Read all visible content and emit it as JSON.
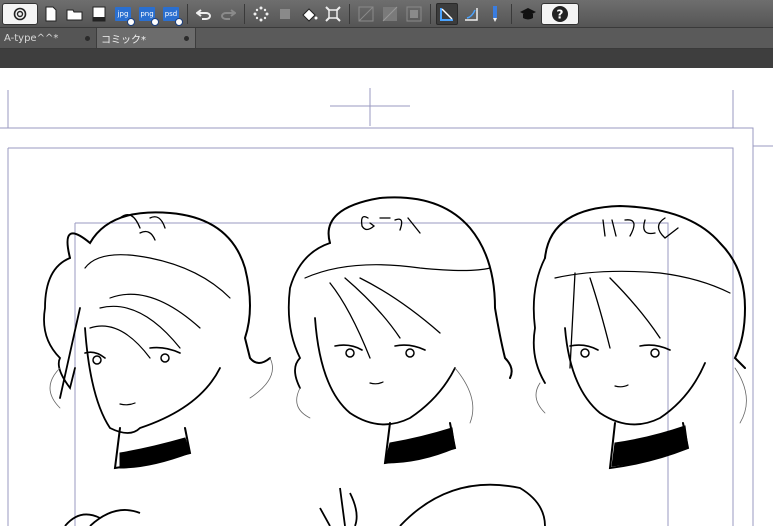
{
  "toolbar": {
    "icons": [
      "app-logo-icon",
      "new-file-icon",
      "open-folder-icon",
      "save-icon",
      "export-jpg-icon",
      "export-png-icon",
      "export-psd-icon",
      "undo-icon",
      "redo-icon",
      "sparkle-icon",
      "transform-icon",
      "fill-icon",
      "crop-icon",
      "grid-icon",
      "ruler-icon",
      "frame-icon",
      "snap-ruler-icon",
      "snap-special-icon",
      "pen-icon",
      "learn-icon",
      "help-icon"
    ],
    "export_jpg": "jpg",
    "export_png": "png",
    "export_psd": "psd",
    "help_symbol": "?"
  },
  "tabs": [
    {
      "label": "A-type^^*",
      "active": false
    },
    {
      "label": "コミック*",
      "active": true
    }
  ],
  "canvas": {
    "labels": [
      "みどぺン",
      "Gラス",
      "リョルG"
    ]
  },
  "colors": {
    "toolbar": "#606060",
    "tab_active": "#6c6c6c",
    "canvas": "#ffffff",
    "guide": "#9a9ac0"
  }
}
